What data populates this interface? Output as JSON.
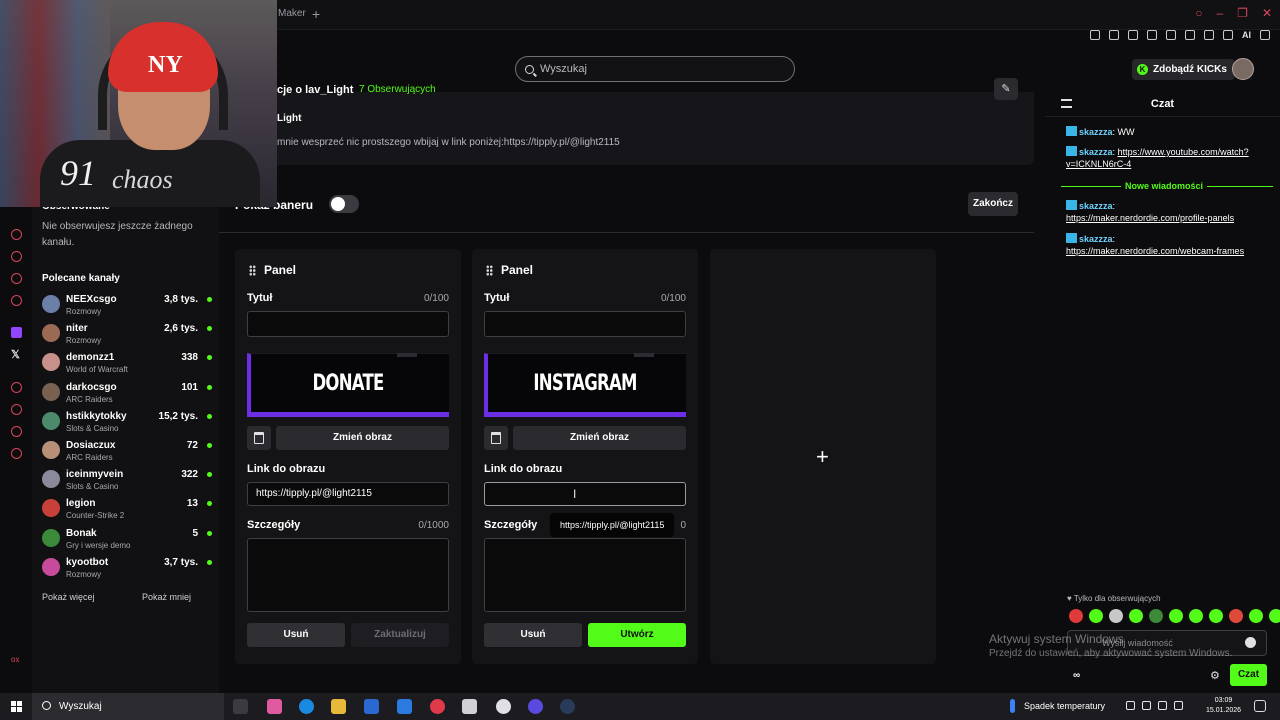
{
  "browser": {
    "tab_label": "Maker",
    "new_tab": "+",
    "ai_label": "AI"
  },
  "header": {
    "search_placeholder": "Wyszukaj",
    "kicks_button": "Zdobądź KICKs"
  },
  "webcam": {
    "cap_logo": "NY",
    "shirt_number": "91",
    "shirt_text": "chaos"
  },
  "sidebar": {
    "followed_title": "Obserwowane",
    "followed_empty": "Nie obserwujesz jeszcze żadnego kanału.",
    "recommended_title": "Polecane kanały",
    "channels": [
      {
        "name": "NEEXcsgo",
        "category": "Rozmowy",
        "viewers": "3,8 tys.",
        "color": "#6b7fa8"
      },
      {
        "name": "niter",
        "category": "Rozmowy",
        "viewers": "2,6 tys.",
        "color": "#9a6a55"
      },
      {
        "name": "demonzz1",
        "category": "World of Warcraft",
        "viewers": "338",
        "color": "#c8908a"
      },
      {
        "name": "darkocsgo",
        "category": "ARC Raiders",
        "viewers": "101",
        "color": "#7a6050"
      },
      {
        "name": "hstikkytokky",
        "category": "Slots & Casino",
        "viewers": "15,2 tys.",
        "color": "#4b8a6a"
      },
      {
        "name": "Dosiaczux",
        "category": "ARC Raiders",
        "viewers": "72",
        "color": "#b89078"
      },
      {
        "name": "iceinmyvein",
        "category": "Slots & Casino",
        "viewers": "322",
        "color": "#8a8a9a"
      },
      {
        "name": "legion",
        "category": "Counter-Strike 2",
        "viewers": "13",
        "color": "#c8403a"
      },
      {
        "name": "Bonak",
        "category": "Gry i wersje demo",
        "viewers": "5",
        "color": "#3a8a3a"
      },
      {
        "name": "kyootbot",
        "category": "Rozmowy",
        "viewers": "3,7 tys.",
        "color": "#c84a9a"
      }
    ],
    "show_more": "Pokaż więcej",
    "show_less": "Pokaż mniej"
  },
  "about": {
    "title": "cje o lav_Light",
    "followers": "7 Obserwujących",
    "subtitle": "Light",
    "description": "mnie wesprzeć nic prostszego wbijaj w link poniżej:https://tipply.pl/@light2115"
  },
  "banner_toggle": {
    "label": "Pokaż baneru",
    "on": false
  },
  "finish_button": "Zakończ",
  "panels": [
    {
      "heading": "Panel",
      "title_label": "Tytuł",
      "title_count": "0/100",
      "title_value": "",
      "banner_text": "DONATE",
      "change_image": "Zmień obraz",
      "link_label": "Link do obrazu",
      "link_value": "https://tipply.pl/@light2115",
      "details_label": "Szczegóły",
      "details_count": "0/1000",
      "remove": "Usuń",
      "action": "Zaktualizuj"
    },
    {
      "heading": "Panel",
      "title_label": "Tytuł",
      "title_count": "0/100",
      "title_value": "",
      "banner_text": "INSTAGRAM",
      "change_image": "Zmień obraz",
      "link_label": "Link do obrazu",
      "link_value": "",
      "details_label": "Szczegóły",
      "details_count": "0",
      "tooltip": "https://tipply.pl/@light2115",
      "remove": "Usuń",
      "action": "Utwórz"
    }
  ],
  "add_panel": "+",
  "chat": {
    "title": "Czat",
    "messages": [
      {
        "user": "skazzza",
        "text": " WW",
        "link": ""
      },
      {
        "user": "skazzza",
        "text": " ",
        "link": "https://www.youtube.com/watch?v=ICKNLN6rC-4"
      },
      {
        "user": "skazzza",
        "text": " ",
        "link": "https://maker.nerdordie.com/profile-panels"
      },
      {
        "user": "skazzza",
        "text": " ",
        "link": "https://maker.nerdordie.com/webcam-frames"
      }
    ],
    "new_messages": "Nowe wiadomości",
    "followers_only": "Tylko dla obserwujących",
    "emote_colors": [
      "#e03a3a",
      "#53fc18",
      "#c8c8c8",
      "#53fc18",
      "#3a8a3a",
      "#53fc18",
      "#53fc18",
      "#53fc18",
      "#e04a3a",
      "#53fc18",
      "#53fc18"
    ],
    "input_placeholder": "Wyślij wiadomość",
    "bottom_label": "∞",
    "send": "Czat"
  },
  "watermark": {
    "line1": "Aktywuj system Windows",
    "line2": "Przejdź do ustawień, aby aktywować system Windows."
  },
  "taskbar": {
    "search_label": "Wyszukaj",
    "weather": "Spadek temperatury",
    "time": "03:09",
    "date": "15.01.2026"
  }
}
